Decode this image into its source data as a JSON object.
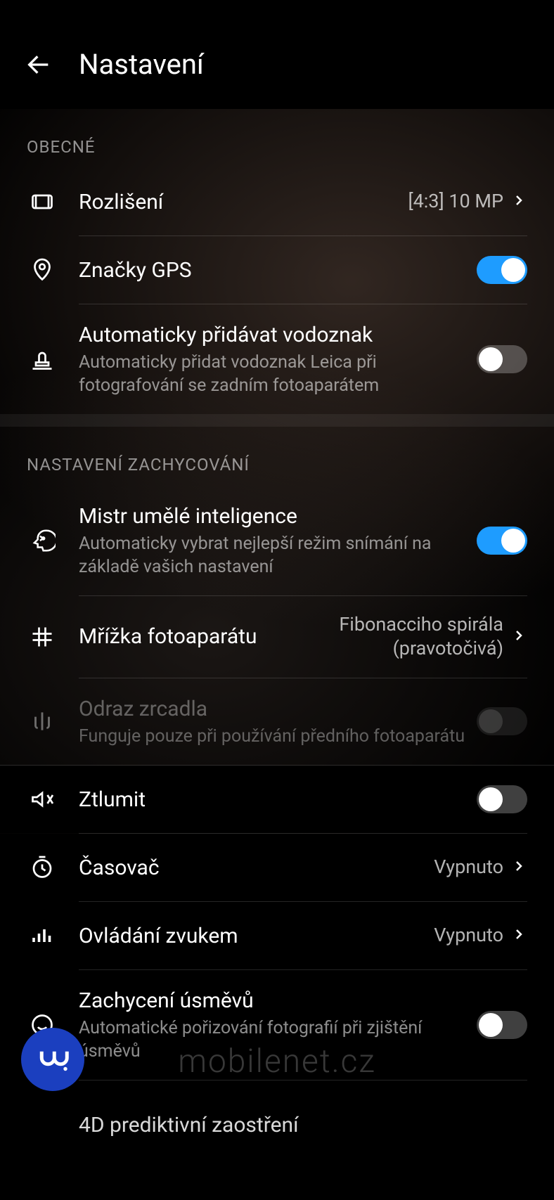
{
  "header": {
    "title": "Nastavení"
  },
  "sections": {
    "general": {
      "header": "OBECNÉ",
      "resolution": {
        "label": "Rozlišení",
        "value": "[4:3] 10 MP"
      },
      "gps": {
        "label": "Značky GPS",
        "on": true
      },
      "watermark": {
        "label": "Automaticky přidávat vodoznak",
        "sub": "Automaticky přidat vodoznak Leica při fotografování se zadním fotoaparátem",
        "on": false
      }
    },
    "capture": {
      "header": "NASTAVENÍ ZACHYCOVÁNÍ",
      "ai": {
        "label": "Mistr umělé inteligence",
        "sub": "Automaticky vybrat nejlepší režim snímání na základě vašich nastavení",
        "on": true
      },
      "grid": {
        "label": "Mřížka fotoaparátu",
        "value": "Fibonacciho spirála (pravotočivá)"
      },
      "mirror": {
        "label": "Odraz zrcadla",
        "sub": "Funguje pouze při používání předního fotoaparátu",
        "on": false
      },
      "mute": {
        "label": "Ztlumit",
        "on": false
      },
      "timer": {
        "label": "Časovač",
        "value": "Vypnuto"
      },
      "audio": {
        "label": "Ovládání zvukem",
        "value": "Vypnuto"
      },
      "smile": {
        "label": "Zachycení úsměvů",
        "sub": "Automatické pořizování fotografií při zjištění úsměvů",
        "on": false
      },
      "predictive": {
        "label": "4D prediktivní zaostření"
      }
    }
  },
  "watermark_text": "mobilenet.cz"
}
